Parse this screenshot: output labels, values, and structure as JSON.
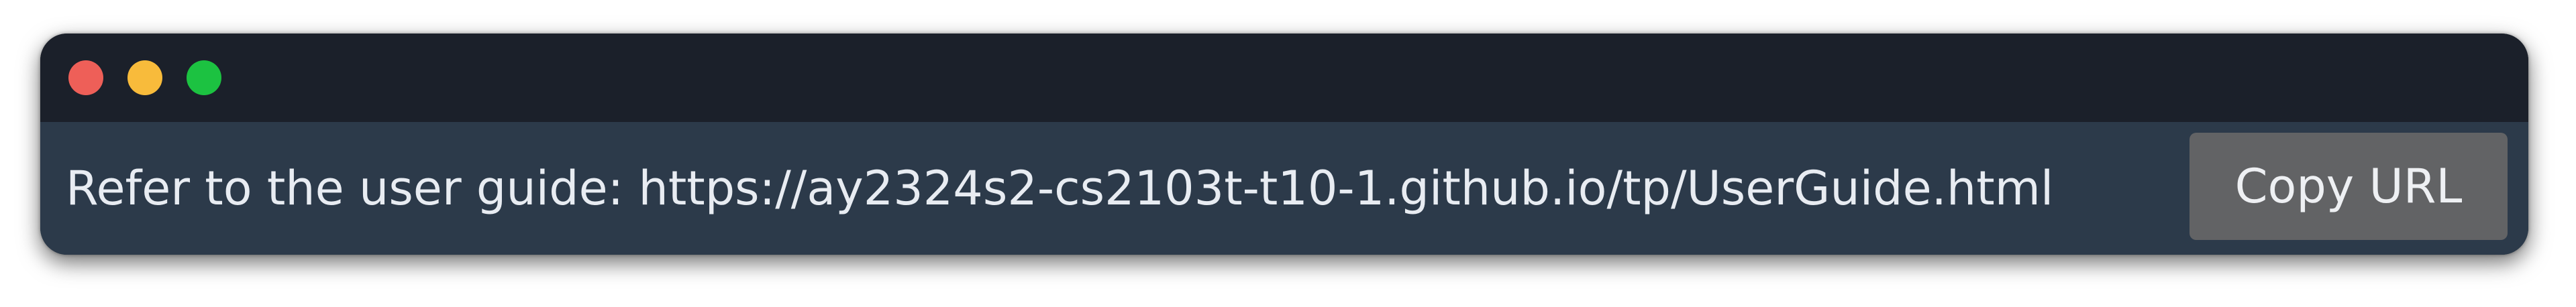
{
  "window": {
    "controls": [
      {
        "name": "close",
        "color": "#ee5f58"
      },
      {
        "name": "minimize",
        "color": "#f8bb3b"
      },
      {
        "name": "maximize",
        "color": "#1cc241"
      }
    ]
  },
  "help": {
    "message": "Refer to the user guide: https://ay2324s2-cs2103t-t10-1.github.io/tp/UserGuide.html",
    "copy_label": "Copy URL"
  }
}
